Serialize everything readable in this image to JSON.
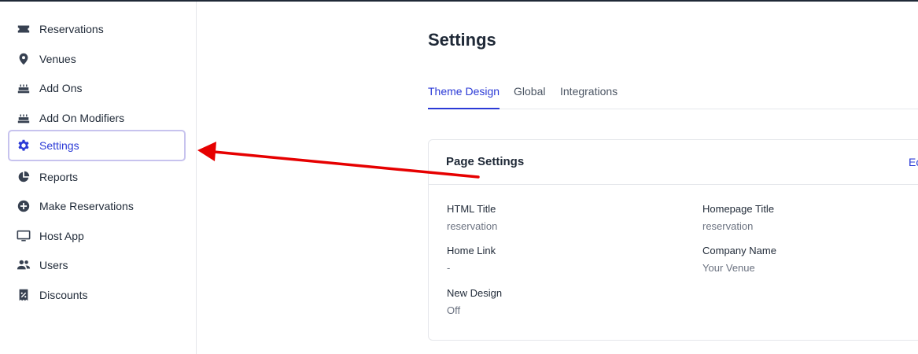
{
  "sidebar": {
    "items": [
      {
        "label": "Reservations",
        "icon": "ticket-icon"
      },
      {
        "label": "Venues",
        "icon": "map-pin-icon"
      },
      {
        "label": "Add Ons",
        "icon": "cake-icon"
      },
      {
        "label": "Add On Modifiers",
        "icon": "cake-icon"
      },
      {
        "label": "Settings",
        "icon": "gear-icon",
        "active": true
      },
      {
        "label": "Reports",
        "icon": "pie-chart-icon"
      },
      {
        "label": "Make Reservations",
        "icon": "plus-circle-icon"
      },
      {
        "label": "Host App",
        "icon": "monitor-icon"
      },
      {
        "label": "Users",
        "icon": "users-icon"
      },
      {
        "label": "Discounts",
        "icon": "receipt-percent-icon"
      }
    ]
  },
  "page": {
    "title": "Settings",
    "tabs": [
      {
        "label": "Theme Design",
        "active": true
      },
      {
        "label": "Global"
      },
      {
        "label": "Integrations"
      }
    ]
  },
  "card": {
    "title": "Page Settings",
    "edit_label": "Ec",
    "fields": [
      {
        "key": "HTML Title",
        "value": "reservation"
      },
      {
        "key": "Homepage Title",
        "value": "reservation"
      },
      {
        "key": "Home Link",
        "value": "-"
      },
      {
        "key": "Company Name",
        "value": "Your Venue"
      },
      {
        "key": "New Design",
        "value": "Off"
      }
    ]
  },
  "colors": {
    "accent": "#2b3ad6",
    "annotation_arrow": "#e60000",
    "active_outline": "#c7c3ee"
  }
}
